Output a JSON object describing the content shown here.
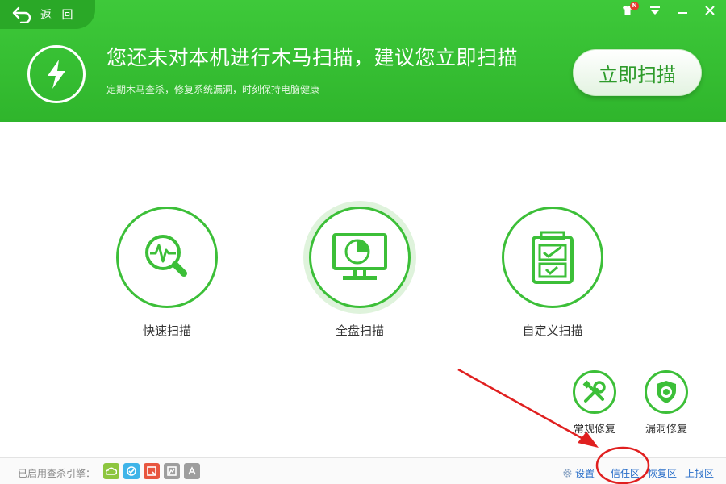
{
  "window": {
    "back_label": "返 回",
    "notification_badge": "N"
  },
  "banner": {
    "headline": "您还未对本机进行木马扫描，建议您立即扫描",
    "subline": "定期木马查杀，修复系统漏洞，时刻保持电脑健康",
    "scan_button": "立即扫描"
  },
  "scan_options": [
    {
      "label": "快速扫描",
      "icon": "quick-scan-icon",
      "selected": false
    },
    {
      "label": "全盘扫描",
      "icon": "full-scan-icon",
      "selected": true
    },
    {
      "label": "自定义扫描",
      "icon": "custom-scan-icon",
      "selected": false
    }
  ],
  "repair_options": [
    {
      "label": "常规修复",
      "icon": "wrench-screwdriver-icon"
    },
    {
      "label": "漏洞修复",
      "icon": "shield-icon"
    }
  ],
  "footer": {
    "engine_label": "已启用查杀引擎：",
    "engines": [
      {
        "name": "cloud-engine-icon",
        "color": "#8dc63f"
      },
      {
        "name": "qvm-engine-icon",
        "color": "#3fb4e8"
      },
      {
        "name": "qex-engine-icon",
        "color": "#e8563f"
      },
      {
        "name": "avira-engine-icon",
        "color": "#9e9e9e"
      },
      {
        "name": "bitdefender-engine-icon",
        "color": "#9e9e9e"
      }
    ],
    "settings": "设置",
    "trust_zone": "信任区",
    "restore_zone": "恢复区",
    "report_zone": "上报区"
  },
  "colors": {
    "brand_green": "#3cbf38",
    "link_blue": "#2a6fc9",
    "annotation_red": "#e02020"
  }
}
